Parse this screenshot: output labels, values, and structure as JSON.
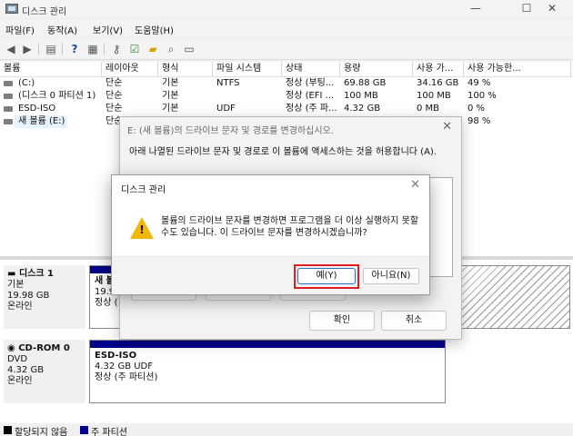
{
  "window": {
    "title": "디스크 관리",
    "minimize": "—",
    "maximize": "☐",
    "close": "✕"
  },
  "menu": [
    "파일(F)",
    "동작(A)",
    "보기(V)",
    "도움말(H)"
  ],
  "toolbar_icons": [
    "back-icon",
    "forward-icon",
    "list-icon",
    "help-icon",
    "grid-icon",
    "key-icon",
    "check-icon",
    "folder-icon",
    "search-icon",
    "properties-icon"
  ],
  "volume_table": {
    "columns": [
      "볼륨",
      "레이아웃",
      "형식",
      "파일 시스템",
      "상태",
      "용량",
      "사용 가...",
      "사용 가능한..."
    ],
    "rows": [
      [
        "(C:)",
        "단순",
        "기본",
        "NTFS",
        "정상 (부팅...",
        "69.88 GB",
        "34.16 GB",
        "49 %"
      ],
      [
        "(디스크 0 파티션 1)",
        "단순",
        "기본",
        "",
        "정상 (EFI ...",
        "100 MB",
        "100 MB",
        "100 %"
      ],
      [
        "ESD-ISO",
        "단순",
        "기본",
        "UDF",
        "정상 (주 파...",
        "4.32 GB",
        "0 MB",
        "0 %"
      ],
      [
        "새 볼륨 (E:)",
        "단순",
        "",
        "",
        "",
        "",
        "",
        "98 %"
      ]
    ]
  },
  "disks": {
    "disk1": {
      "name": "디스크 1",
      "type": "기본",
      "size": "19.98 GB",
      "status": "온라인",
      "partition": {
        "name": "새 볼",
        "size": "19.98",
        "status": "정상 ("
      }
    },
    "cdrom0": {
      "name": "CD-ROM 0",
      "type": "DVD",
      "size": "4.32 GB",
      "status": "온라인",
      "partition": {
        "name": "ESD-ISO",
        "size": "4.32 GB UDF",
        "status": "정상 (주 파티션)"
      }
    }
  },
  "legend": {
    "unallocated": "할당되지 않음",
    "primary": "주 파티션",
    "unallocated_color": "#000000",
    "primary_color": "#00008b"
  },
  "back_dialog": {
    "title": "E: (새 볼륨)의 드라이브 문자 및 경로를 변경하십시오.",
    "text": "아래 나열된 드라이브 문자 및 경로로 이 볼륨에 액세스하는 것을 허용합니다 (A).",
    "ok": "확인",
    "cancel": "취소"
  },
  "front_dialog": {
    "title": "디스크 관리",
    "message": "볼륨의 드라이브 문자를 변경하면 프로그램을 더 이상 실행하지 못할 수도 있습니다. 이 드라이브 문자를 변경하시겠습니까?",
    "yes": "예(Y)",
    "no": "아니요(N)",
    "highlight_color": "#e02020"
  }
}
